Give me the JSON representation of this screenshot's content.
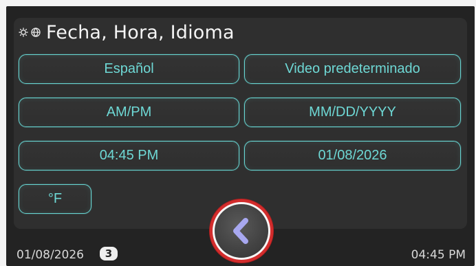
{
  "header": {
    "title": "Fecha, Hora, Idioma",
    "icons": [
      "settings-gear-icon",
      "globe-icon"
    ]
  },
  "buttons": {
    "language": "Español",
    "video_default": "Video predeterminado",
    "time_format": "AM/PM",
    "date_format": "MM/DD/YYYY",
    "time": "04:45 PM",
    "date": "01/08/2026",
    "temperature_unit": "°F"
  },
  "footer": {
    "date": "01/08/2026",
    "badge": "3",
    "time": "04:45 PM"
  },
  "navigation": {
    "back_icon": "chevron-left-icon"
  },
  "colors": {
    "screen_background": "#232323",
    "panel_background": "#2f2f2f",
    "accent_teal": "#67d4d1",
    "back_button_ring": "#d32d2d",
    "back_arrow": "#a8a8f0"
  }
}
